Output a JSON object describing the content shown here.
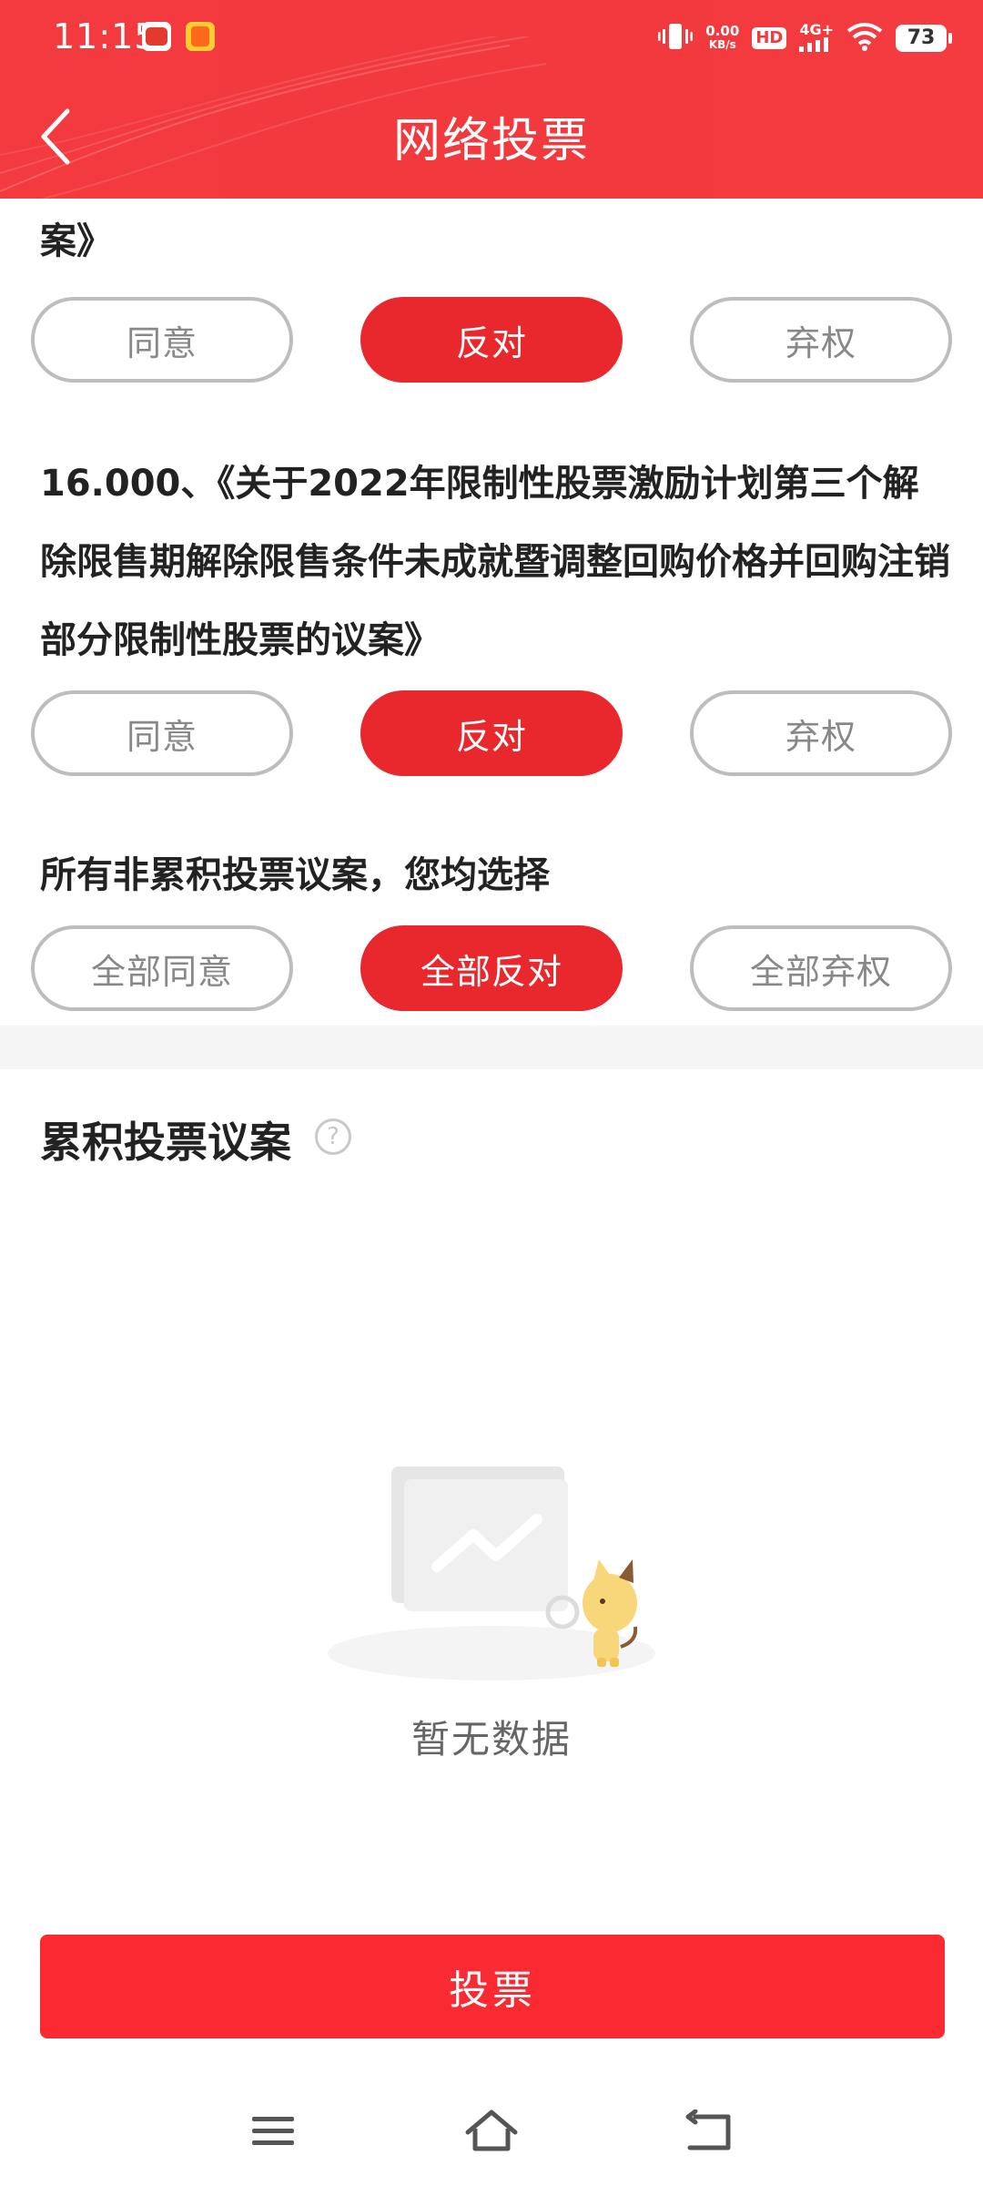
{
  "status_bar": {
    "time": "11:15",
    "net_speed_value": "0.00",
    "net_speed_unit": "KB/s",
    "hd_label": "HD",
    "signal_label": "4G+",
    "battery": "73"
  },
  "header": {
    "title": "网络投票",
    "background_color": "#f23a3e"
  },
  "prev_proposal": {
    "trailing_text": "案》",
    "options": [
      "同意",
      "反对",
      "弃权"
    ],
    "selected": "反对"
  },
  "proposal_16": {
    "text": "16.000、《关于2022年限制性股票激励计划第三个解除限售期解除限售条件未成就暨调整回购价格并回购注销部分限制性股票的议案》",
    "options": [
      "同意",
      "反对",
      "弃权"
    ],
    "selected": "反对"
  },
  "all_non_cumulative": {
    "label": "所有非累积投票议案，您均选择",
    "options": [
      "全部同意",
      "全部反对",
      "全部弃权"
    ],
    "selected": "全部反对"
  },
  "cumulative": {
    "section_title": "累积投票议案",
    "help_icon": "question-circle-icon",
    "empty_text": "暂无数据"
  },
  "vote_button_label": "投票",
  "nav": {
    "menu_icon": "menu-icon",
    "home_icon": "home-icon",
    "back_icon": "back-icon"
  },
  "colors": {
    "accent": "#e8282d",
    "vote_button": "#fa2a33",
    "unselected_border": "#bdbdbd"
  }
}
